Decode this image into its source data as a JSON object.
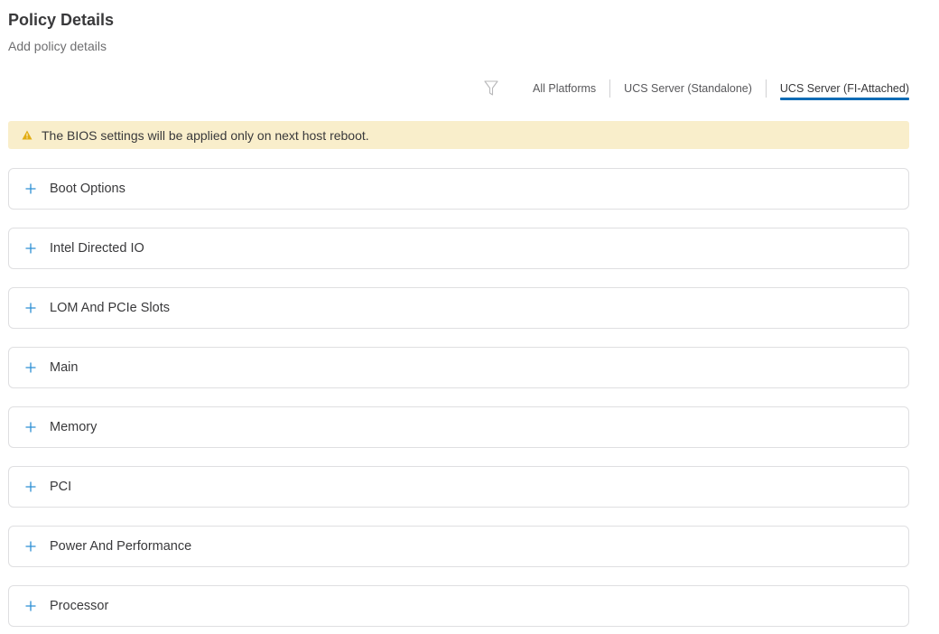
{
  "header": {
    "title": "Policy Details",
    "subtitle": "Add policy details"
  },
  "filter": {
    "icon": "filter-icon",
    "tabs": [
      {
        "label": "All Platforms",
        "active": false
      },
      {
        "label": "UCS Server (Standalone)",
        "active": false
      },
      {
        "label": "UCS Server (FI-Attached)",
        "active": true
      }
    ]
  },
  "warning": {
    "icon": "warning-icon",
    "text": "The BIOS settings will be applied only on next host reboot."
  },
  "sections": [
    {
      "label": "Boot Options"
    },
    {
      "label": "Intel Directed IO"
    },
    {
      "label": "LOM And PCIe Slots"
    },
    {
      "label": "Main"
    },
    {
      "label": "Memory"
    },
    {
      "label": "PCI"
    },
    {
      "label": "Power And Performance"
    },
    {
      "label": "Processor"
    }
  ],
  "colors": {
    "accent": "#0d6bb5",
    "plus": "#2c8fd4",
    "warning_bg": "#f9eecb",
    "warning_icon": "#e2ad13",
    "border": "#dfdfe1"
  }
}
